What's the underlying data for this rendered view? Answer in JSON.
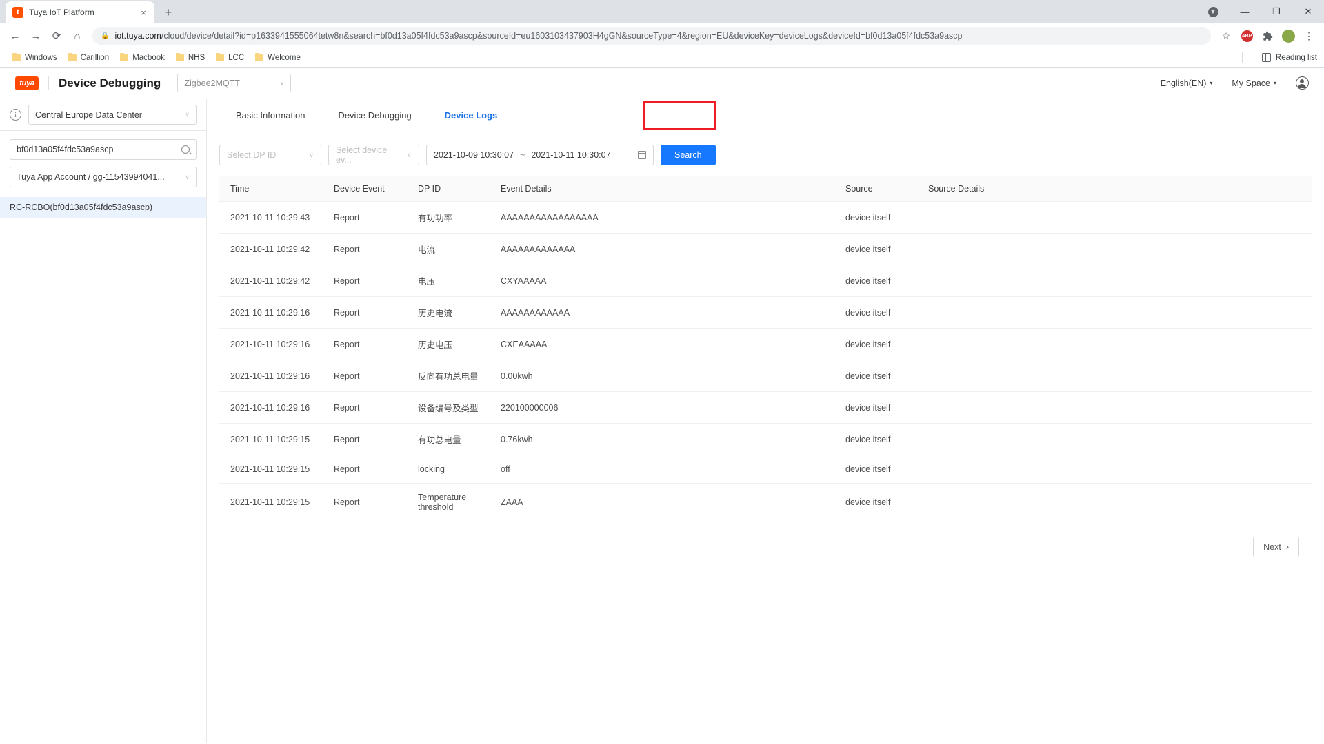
{
  "browser": {
    "tab": {
      "title": "Tuya IoT Platform",
      "favicon": "t",
      "close_label": "×"
    },
    "new_tab_label": "+",
    "window_controls": {
      "minimize": "—",
      "maximize": "❐",
      "close": "✕",
      "update": "▼"
    },
    "nav": {
      "back": "←",
      "forward": "→",
      "reload": "⟳",
      "home": "⌂"
    },
    "omnibox": {
      "lock": "🔒",
      "host": "iot.tuya.com",
      "path": "/cloud/device/detail?id=p1633941555064tetw8n&search=bf0d13a05f4fdc53a9ascp&sourceId=eu1603103437903H4gGN&sourceType=4&region=EU&deviceKey=deviceLogs&deviceId=bf0d13a05f4fdc53a9ascp"
    },
    "toolbar": {
      "star": "☆",
      "adblock": "ABP",
      "extensions": "✦",
      "menu": "⋮"
    },
    "bookmarks": [
      "Windows",
      "Carillion",
      "Macbook",
      "NHS",
      "LCC",
      "Welcome"
    ],
    "reading_list": "Reading list"
  },
  "header": {
    "logo": "tuya",
    "title": "Device Debugging",
    "product_select": {
      "value": "Zigbee2MQTT",
      "caret": "∨"
    },
    "language": "English(EN)",
    "workspace": "My Space",
    "caret": "▾"
  },
  "sidebar": {
    "data_center": {
      "value": "Central Europe Data Center",
      "caret": "∨"
    },
    "info_icon_label": "i",
    "search": {
      "value": "bf0d13a05f4fdc53a9ascp",
      "placeholder": "Search"
    },
    "account": {
      "value": "Tuya App Account / gg-11543994041...",
      "caret": "∨"
    },
    "devices": [
      "RC-RCBO(bf0d13a05f4fdc53a9ascp)"
    ]
  },
  "main": {
    "tabs": [
      {
        "label": "Basic Information",
        "active": false
      },
      {
        "label": "Device Debugging",
        "active": false
      },
      {
        "label": "Device Logs",
        "active": true
      }
    ],
    "highlight_color": "#ee1c24",
    "filters": {
      "dp_placeholder": "Select DP ID",
      "event_placeholder": "Select device ev...",
      "date_start": "2021-10-09 10:30:07",
      "date_sep": "~",
      "date_end": "2021-10-11 10:30:07",
      "search_label": "Search"
    },
    "table": {
      "columns": [
        "Time",
        "Device Event",
        "DP ID",
        "Event Details",
        "Source",
        "Source Details"
      ],
      "rows": [
        {
          "time": "2021-10-11 10:29:43",
          "event": "Report",
          "dp": "有功功率",
          "details": "AAAAAAAAAAAAAAAAA",
          "source": "device itself",
          "source_details": ""
        },
        {
          "time": "2021-10-11 10:29:42",
          "event": "Report",
          "dp": "电流",
          "details": "AAAAAAAAAAAAA",
          "source": "device itself",
          "source_details": ""
        },
        {
          "time": "2021-10-11 10:29:42",
          "event": "Report",
          "dp": "电压",
          "details": "CXYAAAAA",
          "source": "device itself",
          "source_details": ""
        },
        {
          "time": "2021-10-11 10:29:16",
          "event": "Report",
          "dp": "历史电流",
          "details": "AAAAAAAAAAAA",
          "source": "device itself",
          "source_details": ""
        },
        {
          "time": "2021-10-11 10:29:16",
          "event": "Report",
          "dp": "历史电压",
          "details": "CXEAAAAA",
          "source": "device itself",
          "source_details": ""
        },
        {
          "time": "2021-10-11 10:29:16",
          "event": "Report",
          "dp": "反向有功总电量",
          "details": "0.00kwh",
          "source": "device itself",
          "source_details": ""
        },
        {
          "time": "2021-10-11 10:29:16",
          "event": "Report",
          "dp": "设备编号及类型",
          "details": "220100000006",
          "source": "device itself",
          "source_details": ""
        },
        {
          "time": "2021-10-11 10:29:15",
          "event": "Report",
          "dp": "有功总电量",
          "details": "0.76kwh",
          "source": "device itself",
          "source_details": ""
        },
        {
          "time": "2021-10-11 10:29:15",
          "event": "Report",
          "dp": "locking",
          "details": "off",
          "source": "device itself",
          "source_details": ""
        },
        {
          "time": "2021-10-11 10:29:15",
          "event": "Report",
          "dp": "Temperature threshold",
          "details": "ZAAA",
          "source": "device itself",
          "source_details": ""
        }
      ]
    },
    "pagination": {
      "next_label": "Next",
      "next_caret": "›"
    }
  }
}
